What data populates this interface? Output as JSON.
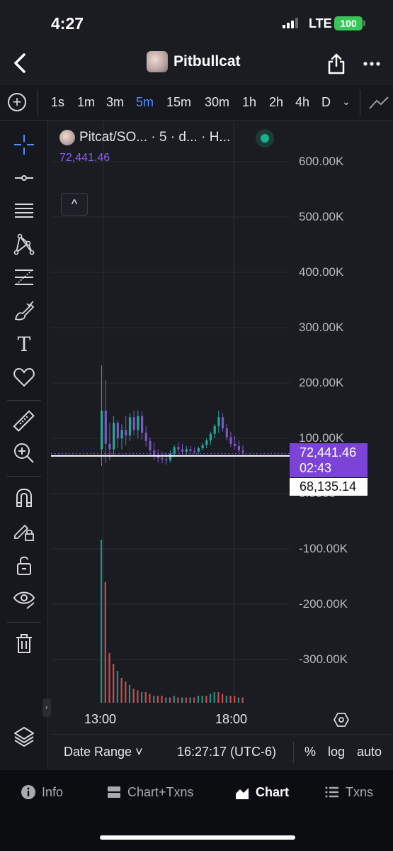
{
  "status_bar": {
    "time": "4:27",
    "network": "LTE",
    "battery": "100"
  },
  "header": {
    "title": "Pitbullcat"
  },
  "toolbar": {
    "intervals": [
      "1s",
      "1m",
      "3m",
      "5m",
      "15m",
      "30m",
      "1h",
      "2h",
      "4h",
      "D"
    ],
    "active_interval": "5m"
  },
  "icons": {
    "back": "chevron-left-icon",
    "share": "share-icon",
    "more": "ellipsis-icon",
    "add": "plus-circle-icon",
    "line_type": "line-chart-icon",
    "tools": [
      "crosshair-icon",
      "horizontal-line-icon",
      "channel-icon",
      "pattern-icon",
      "fib-icon",
      "brush-icon",
      "text-icon",
      "heart-icon",
      "ruler-icon",
      "zoom-in-icon",
      "magnet-icon",
      "lock-pencil-icon",
      "unlock-icon",
      "eye-icon",
      "trash-icon",
      "layers-icon"
    ]
  },
  "chart": {
    "legend_text": "Pitcat/SO...  · 5 · d... · H...",
    "legend_value": "72,441.46",
    "collapse_symbol": "^",
    "price_tag": {
      "price": "72,441.46",
      "countdown": "02:43"
    },
    "cursor_price": "68,135.14"
  },
  "chart_data": {
    "type": "candlestick",
    "y_tick_labels": [
      "600.00K",
      "500.00K",
      "400.00K",
      "300.00K",
      "200.00K",
      "100.00K",
      "0.0000",
      "-100.00K",
      "-200.00K",
      "-300.00K"
    ],
    "x_tick_labels": [
      "13:00",
      "18:00"
    ],
    "ylim": [
      -350000,
      650000
    ],
    "current_price": 72441.46,
    "cursor_price": 68135.14,
    "colors": {
      "up": "#26a69a",
      "down": "#7e57c2",
      "volume_up": "#26a69a",
      "volume_down": "#ef5350"
    },
    "candles": [
      {
        "o": 80000,
        "h": 232000,
        "l": 50000,
        "c": 150000
      },
      {
        "o": 150000,
        "h": 205000,
        "l": 55000,
        "c": 90000
      },
      {
        "o": 90000,
        "h": 128000,
        "l": 60000,
        "c": 80000
      },
      {
        "o": 80000,
        "h": 140000,
        "l": 70000,
        "c": 128000
      },
      {
        "o": 128000,
        "h": 132000,
        "l": 82000,
        "c": 100000
      },
      {
        "o": 100000,
        "h": 125000,
        "l": 80000,
        "c": 115000
      },
      {
        "o": 115000,
        "h": 140000,
        "l": 88000,
        "c": 105000
      },
      {
        "o": 105000,
        "h": 145000,
        "l": 95000,
        "c": 138000
      },
      {
        "o": 138000,
        "h": 150000,
        "l": 105000,
        "c": 115000
      },
      {
        "o": 115000,
        "h": 150000,
        "l": 100000,
        "c": 140000
      },
      {
        "o": 140000,
        "h": 148000,
        "l": 98000,
        "c": 110000
      },
      {
        "o": 110000,
        "h": 122000,
        "l": 85000,
        "c": 95000
      },
      {
        "o": 95000,
        "h": 102000,
        "l": 68000,
        "c": 78000
      },
      {
        "o": 78000,
        "h": 92000,
        "l": 60000,
        "c": 70000
      },
      {
        "o": 70000,
        "h": 80000,
        "l": 56000,
        "c": 64000
      },
      {
        "o": 64000,
        "h": 75000,
        "l": 55000,
        "c": 62000
      },
      {
        "o": 62000,
        "h": 74000,
        "l": 52000,
        "c": 60000
      },
      {
        "o": 60000,
        "h": 78000,
        "l": 56000,
        "c": 72000
      },
      {
        "o": 72000,
        "h": 88000,
        "l": 66000,
        "c": 84000
      },
      {
        "o": 84000,
        "h": 92000,
        "l": 74000,
        "c": 80000
      },
      {
        "o": 80000,
        "h": 90000,
        "l": 72000,
        "c": 76000
      },
      {
        "o": 76000,
        "h": 86000,
        "l": 70000,
        "c": 80000
      },
      {
        "o": 80000,
        "h": 86000,
        "l": 74000,
        "c": 77000
      },
      {
        "o": 77000,
        "h": 84000,
        "l": 72000,
        "c": 76000
      },
      {
        "o": 76000,
        "h": 85000,
        "l": 72000,
        "c": 82000
      },
      {
        "o": 82000,
        "h": 92000,
        "l": 78000,
        "c": 88000
      },
      {
        "o": 88000,
        "h": 100000,
        "l": 82000,
        "c": 96000
      },
      {
        "o": 96000,
        "h": 112000,
        "l": 88000,
        "c": 108000
      },
      {
        "o": 108000,
        "h": 126000,
        "l": 100000,
        "c": 122000
      },
      {
        "o": 122000,
        "h": 150000,
        "l": 110000,
        "c": 138000
      },
      {
        "o": 138000,
        "h": 146000,
        "l": 112000,
        "c": 118000
      },
      {
        "o": 118000,
        "h": 126000,
        "l": 96000,
        "c": 102000
      },
      {
        "o": 102000,
        "h": 112000,
        "l": 84000,
        "c": 90000
      },
      {
        "o": 90000,
        "h": 104000,
        "l": 80000,
        "c": 86000
      },
      {
        "o": 86000,
        "h": 96000,
        "l": 74000,
        "c": 78000
      },
      {
        "o": 78000,
        "h": 88000,
        "l": 70000,
        "c": 74000
      }
    ],
    "volumes": [
      {
        "v": 0.46,
        "up": true
      },
      {
        "v": 0.34,
        "up": false
      },
      {
        "v": 0.14,
        "up": false
      },
      {
        "v": 0.11,
        "up": false
      },
      {
        "v": 0.09,
        "up": true
      },
      {
        "v": 0.07,
        "up": false
      },
      {
        "v": 0.06,
        "up": false
      },
      {
        "v": 0.05,
        "up": true
      },
      {
        "v": 0.04,
        "up": false
      },
      {
        "v": 0.035,
        "up": false
      },
      {
        "v": 0.03,
        "up": true
      },
      {
        "v": 0.03,
        "up": false
      },
      {
        "v": 0.025,
        "up": false
      },
      {
        "v": 0.02,
        "up": true
      },
      {
        "v": 0.02,
        "up": false
      },
      {
        "v": 0.02,
        "up": false
      },
      {
        "v": 0.015,
        "up": true
      },
      {
        "v": 0.015,
        "up": false
      },
      {
        "v": 0.02,
        "up": true
      },
      {
        "v": 0.015,
        "up": false
      },
      {
        "v": 0.015,
        "up": true
      },
      {
        "v": 0.015,
        "up": false
      },
      {
        "v": 0.015,
        "up": true
      },
      {
        "v": 0.015,
        "up": false
      },
      {
        "v": 0.02,
        "up": true
      },
      {
        "v": 0.02,
        "up": true
      },
      {
        "v": 0.02,
        "up": false
      },
      {
        "v": 0.025,
        "up": true
      },
      {
        "v": 0.03,
        "up": true
      },
      {
        "v": 0.03,
        "up": false
      },
      {
        "v": 0.025,
        "up": false
      },
      {
        "v": 0.02,
        "up": true
      },
      {
        "v": 0.02,
        "up": false
      },
      {
        "v": 0.02,
        "up": false
      },
      {
        "v": 0.015,
        "up": true
      },
      {
        "v": 0.015,
        "up": false
      }
    ]
  },
  "bottom_controls": {
    "date_range": "Date Range ˅",
    "clock": "16:27:17 (UTC-6)",
    "percent": "%",
    "log": "log",
    "auto": "auto"
  },
  "tabs": [
    {
      "label": "Info",
      "icon": "info-icon"
    },
    {
      "label": "Chart+Txns",
      "icon": "split-view-icon"
    },
    {
      "label": "Chart",
      "icon": "area-chart-icon",
      "active": true
    },
    {
      "label": "Txns",
      "icon": "list-icon"
    }
  ]
}
